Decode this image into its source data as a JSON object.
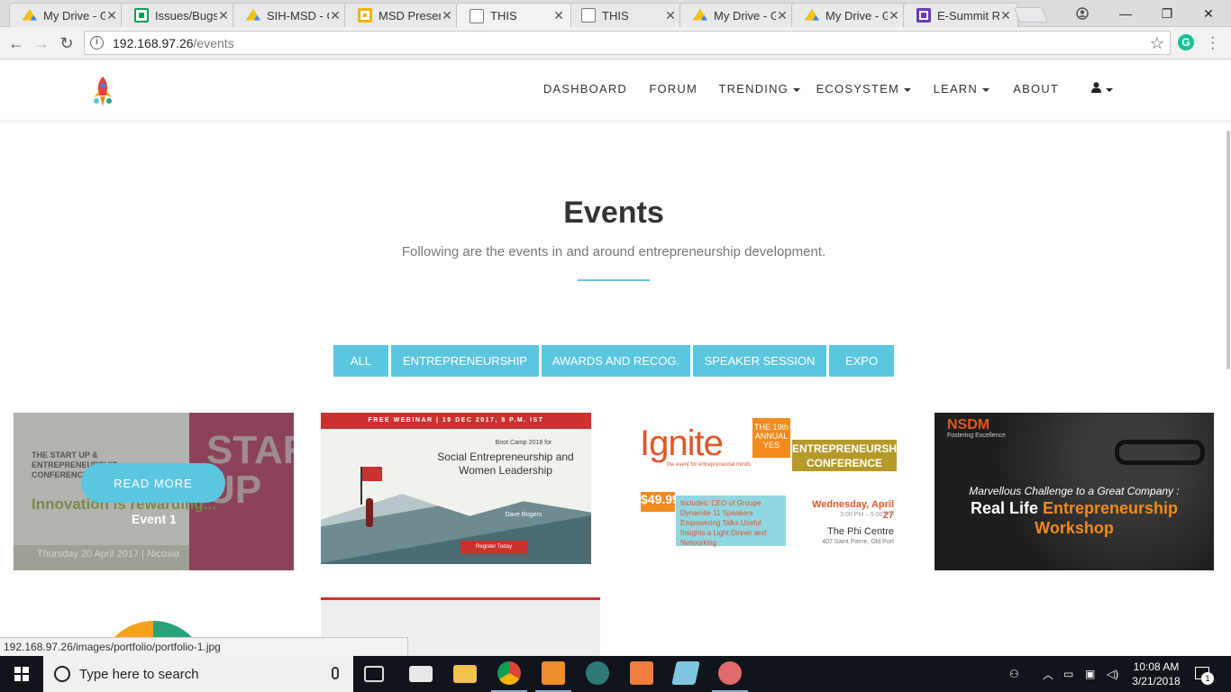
{
  "browser": {
    "tabs": [
      {
        "title": "My Drive - G",
        "icon": "drive-icon"
      },
      {
        "title": "Issues/Bugs",
        "icon": "sheets-icon"
      },
      {
        "title": "SIH-MSD - G",
        "icon": "drive-icon"
      },
      {
        "title": "MSD Presen",
        "icon": "slides-icon"
      },
      {
        "title": "THIS",
        "icon": "doc-icon"
      },
      {
        "title": "THIS",
        "icon": "doc-icon"
      },
      {
        "title": "My Drive - G",
        "icon": "drive-icon"
      },
      {
        "title": "My Drive - G",
        "icon": "drive-icon"
      },
      {
        "title": "E-Summit R",
        "icon": "forms-icon"
      }
    ],
    "active_tab_index": 4,
    "url_host": "192.168.97.26",
    "url_path": "/events",
    "status_url": "192.168.97.26/images/portfolio/portfolio-1.jpg",
    "extension_badge": "G"
  },
  "navbar": {
    "links": [
      {
        "label": "DASHBOARD",
        "dropdown": false
      },
      {
        "label": "FORUM",
        "dropdown": false
      },
      {
        "label": "TRENDING",
        "dropdown": true
      },
      {
        "label": "ECOSYSTEM",
        "dropdown": true
      },
      {
        "label": "LEARN",
        "dropdown": true
      },
      {
        "label": "ABOUT",
        "dropdown": false
      }
    ],
    "user_icon": "user-icon"
  },
  "page": {
    "title": "Events",
    "subtitle": "Following are the events in and around entrepreneurship development.",
    "accent_color": "#5bc6df",
    "filters": [
      "ALL",
      "ENTREPRENEURSHIP",
      "AWARDS AND RECOG.",
      "SPEAKER SESSION",
      "EXPO"
    ]
  },
  "events": [
    {
      "label": "Event 1",
      "hover_button": "READ MORE",
      "poster": {
        "heading": "THE START UP & ENTREPRENEURSHIP CONFERENCE",
        "big": "START UP",
        "tagline": "Innovation is rewarding...",
        "date": "Thursday 20 April 2017 | Nicosia"
      }
    },
    {
      "poster": {
        "bar": "FREE WEBINAR | 19 DEC 2017, 8 P.M. IST",
        "kicker": "Boot Camp 2018 for",
        "heading": "Social Entrepreneurship and Women Leadership",
        "speaker": "Dave Rogers",
        "cta": "Register Today"
      }
    },
    {
      "poster": {
        "brand": "Ignite",
        "brand_sub": "the event for entrepreneurial minds",
        "yes_badge": "THE 19th ANNUAL YES",
        "heading": "ENTREPRENEURSHIP CONFERENCE",
        "price": "$49.99",
        "includes": "Includes: CEO of Groupe Dynamite 11 Speakers Empowering Talks Useful Insights a Light Dinner and Networking",
        "date": "Wednesday, April 27",
        "time": "3:00 PM – 9:00 PM",
        "venue": "The Phi Centre",
        "address": "407 Saint Pierre, Old Port"
      }
    },
    {
      "poster": {
        "brand": "NSDM",
        "brand_sub": "Fostering Excellence",
        "line1": "Marvellous Challenge to a Great Company :",
        "line2a": "Real Life ",
        "line2b": "Entrepreneurship",
        "line3": "Workshop"
      }
    }
  ],
  "taskbar": {
    "search_placeholder": "Type here to search",
    "time": "10:08 AM",
    "date": "3/21/2018",
    "notification_count": "1"
  }
}
